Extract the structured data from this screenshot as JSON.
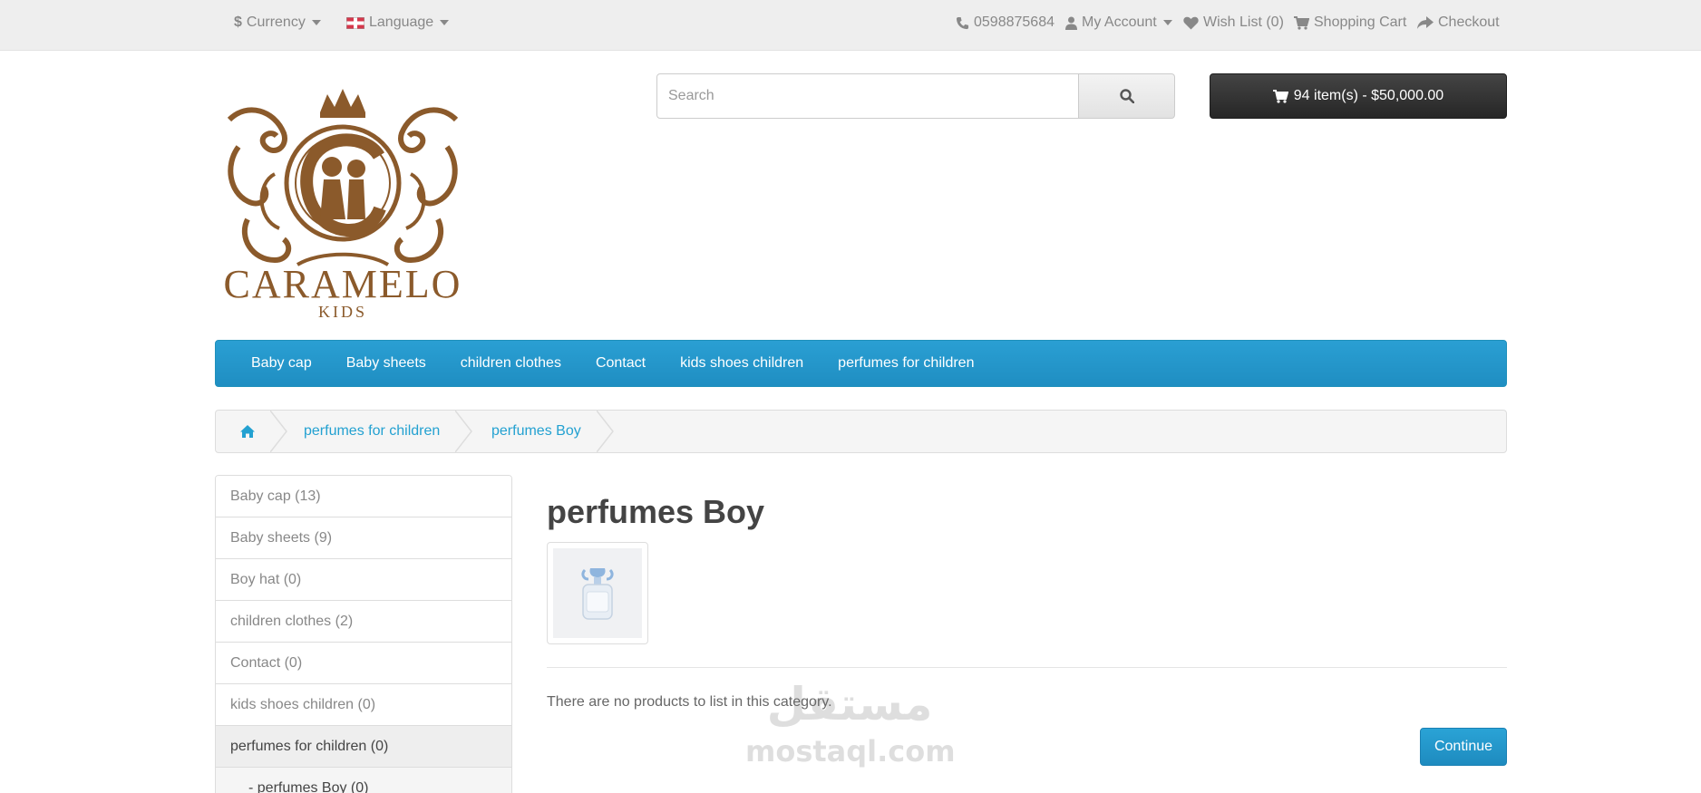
{
  "topbar": {
    "currency_symbol": "$",
    "currency_label": "Currency",
    "language_label": "Language",
    "phone": "0598875684",
    "account_label": "My Account",
    "wishlist_label": "Wish List (0)",
    "cart_label": "Shopping Cart",
    "checkout_label": "Checkout"
  },
  "logo": {
    "brand": "CARAMELO",
    "sub": "KIDS",
    "color": "#8b5a2b"
  },
  "search": {
    "placeholder": "Search"
  },
  "cart": {
    "summary": "94 item(s) - $50,000.00"
  },
  "menu": {
    "items": [
      "Baby cap",
      "Baby sheets",
      "children clothes",
      "Contact",
      "kids shoes children",
      "perfumes for children"
    ]
  },
  "breadcrumb": {
    "items": [
      "perfumes for children",
      "perfumes Boy"
    ]
  },
  "sidebar": {
    "items": [
      "Baby cap (13)",
      "Baby sheets (9)",
      "Boy hat (0)",
      "children clothes (2)",
      "Contact (0)",
      "kids shoes children (0)",
      "perfumes for children (0)",
      "- perfumes Boy (0)"
    ]
  },
  "content": {
    "title": "perfumes Boy",
    "empty_message": "There are no products to list in this category.",
    "continue_label": "Continue"
  },
  "watermark": {
    "arabic": "مستقل",
    "latin": "mostaql.com"
  },
  "colors": {
    "accent": "#229ac8",
    "topbar_bg": "#eeeeee",
    "cart_bg": "#363636",
    "link": "#23a1d1"
  }
}
